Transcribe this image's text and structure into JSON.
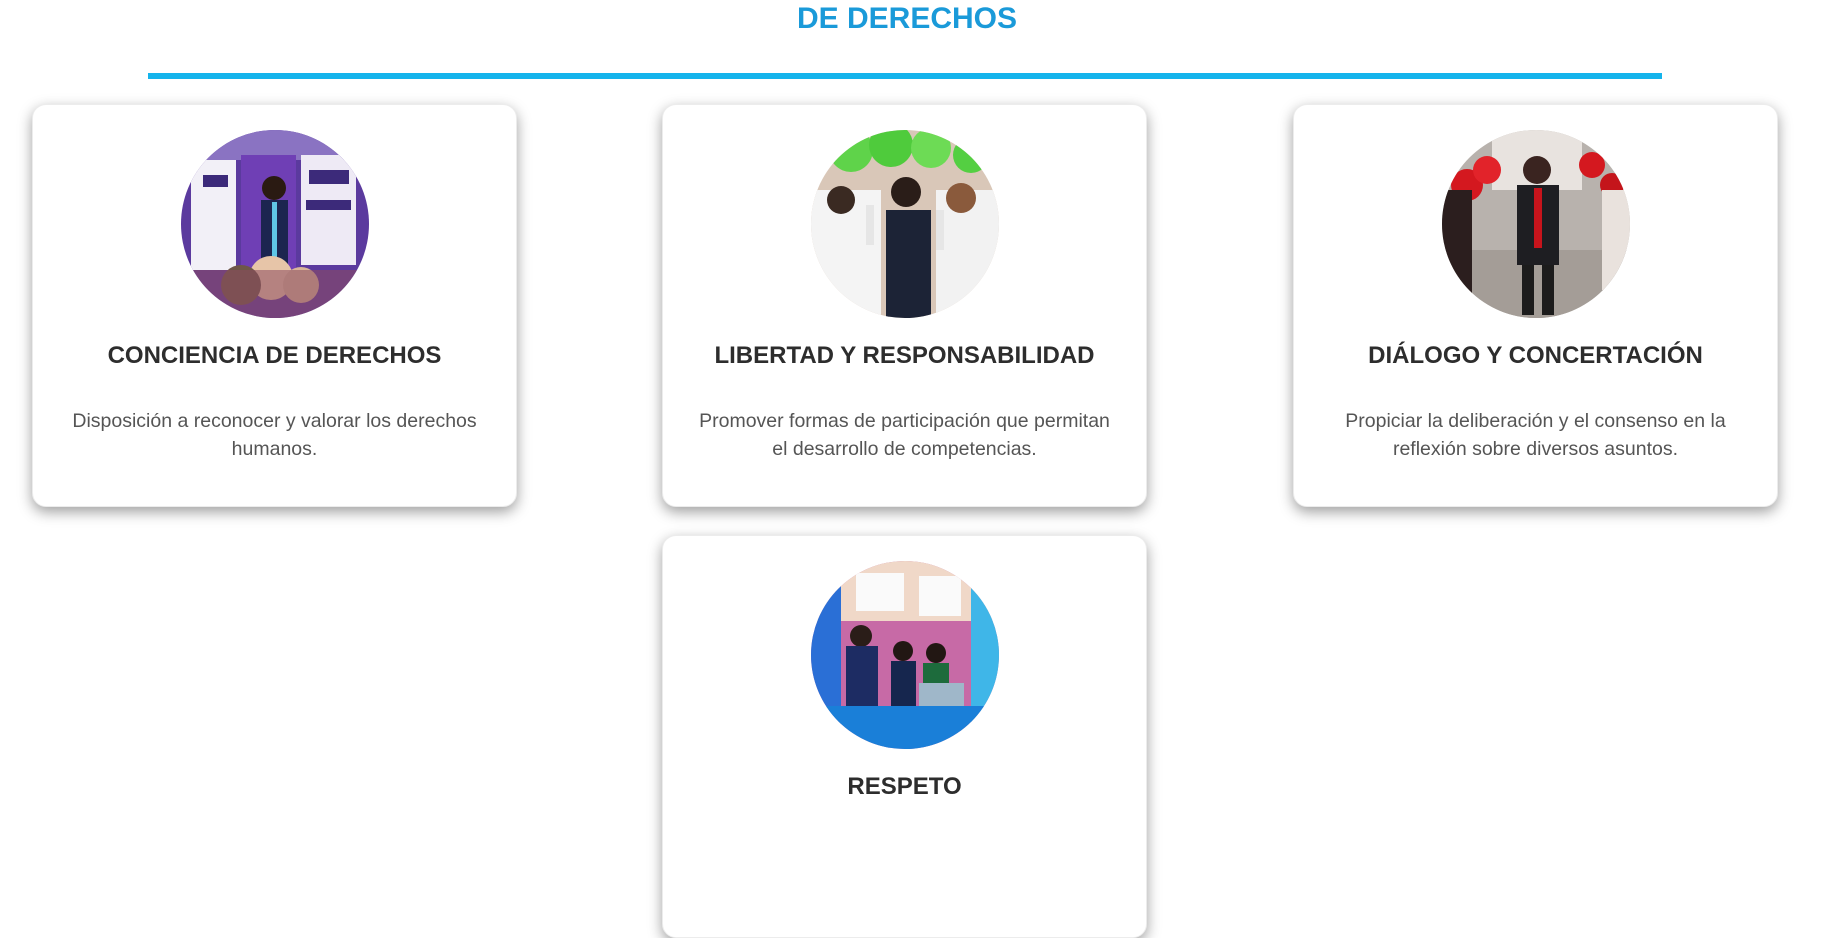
{
  "section": {
    "title": "DE DERECHOS"
  },
  "cards": [
    {
      "title": "CONCIENCIA DE DERECHOS",
      "description": "Disposición a reconocer y valorar los derechos humanos.",
      "image_icon": "photo-student-exhibit"
    },
    {
      "title": "LIBERTAD Y RESPONSABILIDAD",
      "description": "Promover formas de participación que permitan el desarrollo de competencias.",
      "image_icon": "photo-group-with-balloons"
    },
    {
      "title": "DIÁLOGO Y CONCERTACIÓN",
      "description": "Propiciar la deliberación y el consenso en la reflexión sobre diversos asuntos.",
      "image_icon": "photo-parade-red-balloons"
    },
    {
      "title": "RESPETO",
      "description": "",
      "image_icon": "photo-classroom-fair"
    }
  ],
  "colors": {
    "title_blue": "#1a9ad9",
    "divider_blue": "#15b4ec",
    "card_title": "#2d2d2d",
    "card_text": "#555555"
  }
}
